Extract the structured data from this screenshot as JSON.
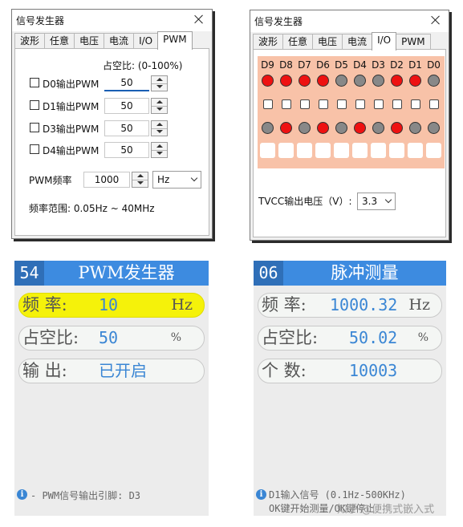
{
  "dialog_pwm": {
    "title": "信号发生器",
    "tabs": [
      "波形",
      "任意",
      "电压",
      "电流",
      "I/O",
      "PWM"
    ],
    "active_tab": "PWM",
    "duty_label": "占空比: (0-100%)",
    "rows": [
      {
        "label": "D0输出PWM",
        "value": "50"
      },
      {
        "label": "D1输出PWM",
        "value": "50"
      },
      {
        "label": "D3输出PWM",
        "value": "50"
      },
      {
        "label": "D4输出PWM",
        "value": "50"
      }
    ],
    "freq_label": "PWM频率",
    "freq_value": "1000",
    "freq_unit": "Hz",
    "range_text": "频率范围: 0.05Hz ~ 40MHz"
  },
  "dialog_io": {
    "title": "信号发生器",
    "tabs": [
      "波形",
      "任意",
      "电压",
      "电流",
      "I/O",
      "PWM"
    ],
    "active_tab": "I/O",
    "pins": [
      "D9",
      "D8",
      "D7",
      "D6",
      "D5",
      "D4",
      "D3",
      "D2",
      "D1",
      "D0"
    ],
    "row1_states": [
      1,
      1,
      1,
      1,
      0,
      0,
      0,
      1,
      1,
      0
    ],
    "row3_states": [
      0,
      1,
      0,
      1,
      0,
      1,
      0,
      1,
      0,
      0
    ],
    "led_on_color": "#ee1111",
    "led_off_color": "#888888",
    "grid_bg": "#f8c2a8",
    "tvcc_label": "TVCC输出电压（V）:",
    "tvcc_value": "3.3"
  },
  "screen_left": {
    "num": "54",
    "title": "PWM发生器",
    "rows": [
      {
        "key": "频  率:",
        "value": "10",
        "unit": "Hz",
        "highlight": true
      },
      {
        "key": "占空比:",
        "value": "50",
        "unit": "%"
      },
      {
        "key": "输  出:",
        "value": "已开启",
        "unit": ""
      }
    ],
    "footer": "- PWM信号输出引脚: D3",
    "highlight_color": "#f5f20a",
    "value_color": "#3a86d4"
  },
  "screen_right": {
    "num": "06",
    "title": "脉冲测量",
    "rows": [
      {
        "key": "频  率:",
        "value": "1000.32",
        "unit": "Hz"
      },
      {
        "key": "占空比:",
        "value": "50.02",
        "unit": "%"
      },
      {
        "key": "个  数:",
        "value": "10003",
        "unit": ""
      }
    ],
    "footer1": "D1输入信号 (0.1Hz-500KHz)",
    "footer2": "OK键开始测量/OK键停止",
    "watermark": "知乎 @便携式嵌入式"
  }
}
